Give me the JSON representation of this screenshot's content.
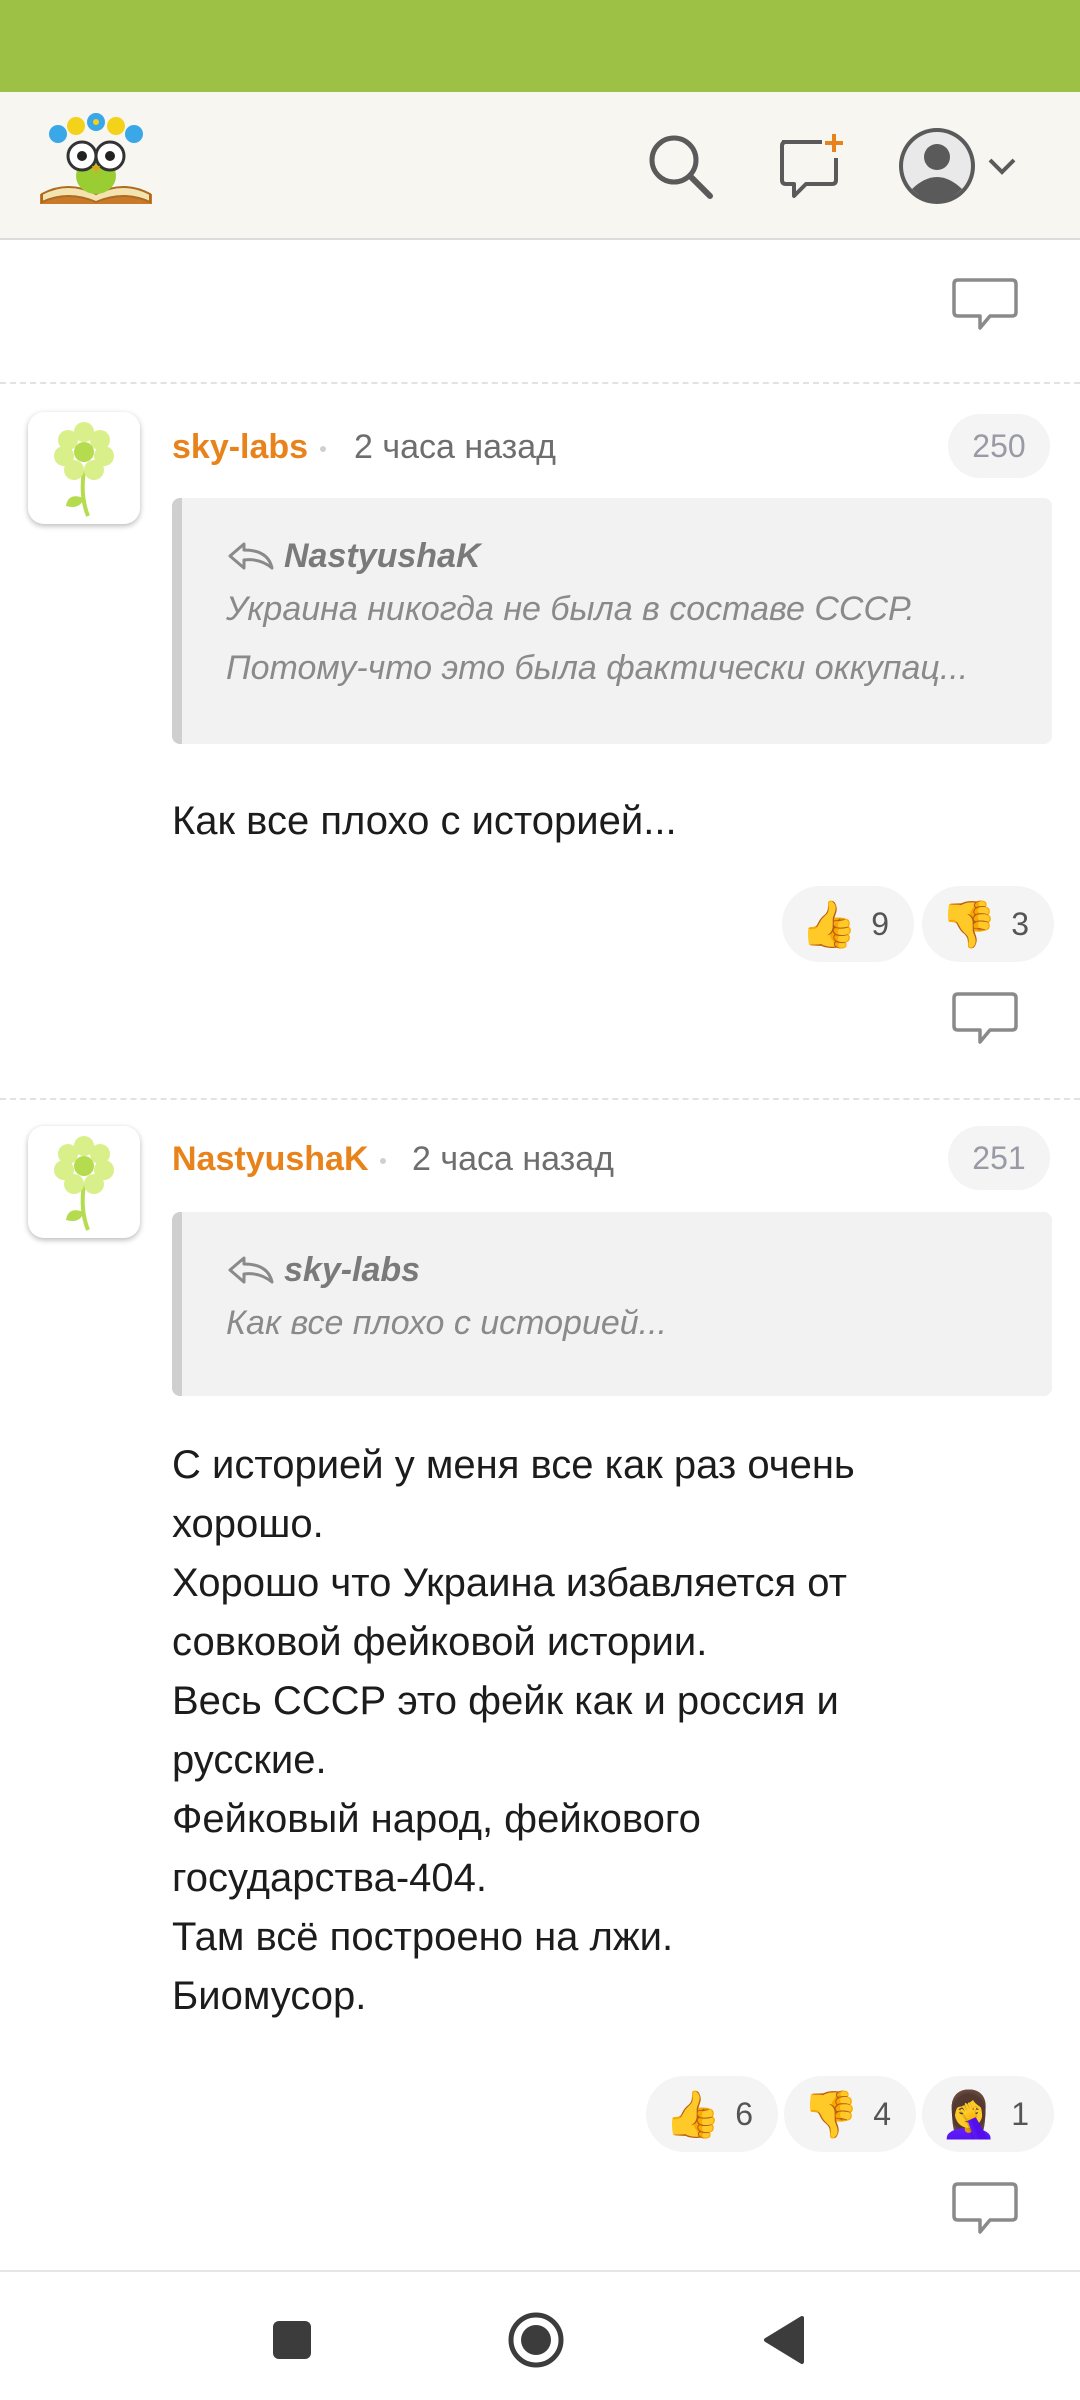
{
  "colors": {
    "status_bar": "#9dc144",
    "author": "#e8821a",
    "header_bg": "#f7f6f1"
  },
  "header": {
    "logo_icon": "book-owl-logo",
    "icons": [
      "search-icon",
      "new-message-icon",
      "user-avatar-icon",
      "chevron-down-icon"
    ]
  },
  "comments": [
    {
      "author": "sky-labs",
      "time": "2 часа назад",
      "number": "250",
      "quote": {
        "author": "NastyushaK",
        "lines": [
          "Украина никогда не была в составе СССР.",
          "Потому-что  это  была  фактически  оккупац..."
        ]
      },
      "body": [
        "Как все плохо с историей..."
      ],
      "reactions": [
        {
          "emoji": "👍",
          "count": "9"
        },
        {
          "emoji": "👎",
          "count": "3"
        }
      ]
    },
    {
      "author": "NastyushaK",
      "time": "2 часа назад",
      "number": "251",
      "quote": {
        "author": "sky-labs",
        "lines": [
          "Как все плохо с историей..."
        ]
      },
      "body": [
        "С историей у меня все как раз очень",
        "хорошо.",
        "Хорошо что Украина избавляется от",
        "совковой фейковой истории.",
        "Весь СССР это фейк как и россия и",
        "русские.",
        "Фейковый народ, фейкового",
        "государства-404.",
        "Там всё построено на лжи.",
        "Биомусор."
      ],
      "reactions": [
        {
          "emoji": "👍",
          "count": "6"
        },
        {
          "emoji": "👎",
          "count": "4"
        },
        {
          "emoji": "🤦‍♀️",
          "count": "1"
        }
      ]
    }
  ]
}
